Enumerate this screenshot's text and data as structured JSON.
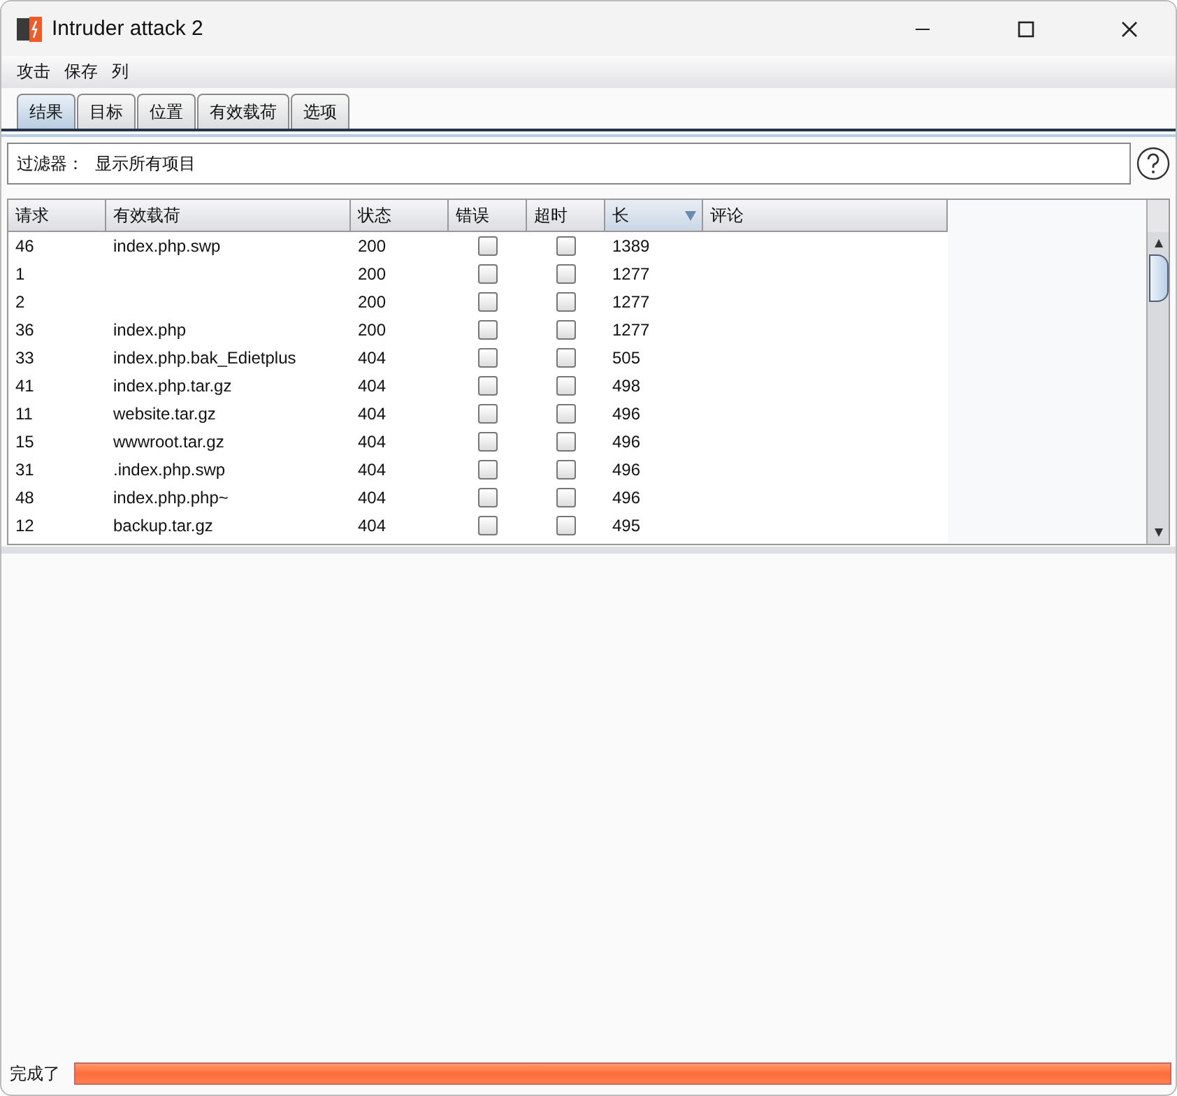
{
  "window": {
    "title": "Intruder attack 2"
  },
  "menu": [
    "攻击",
    "保存",
    "列"
  ],
  "tabs": [
    {
      "label": "结果",
      "selected": true
    },
    {
      "label": "目标",
      "selected": false
    },
    {
      "label": "位置",
      "selected": false
    },
    {
      "label": "有效载荷",
      "selected": false
    },
    {
      "label": "选项",
      "selected": false
    }
  ],
  "filter": {
    "label": "过滤器：",
    "value": "显示所有项目"
  },
  "table": {
    "columns": [
      {
        "label": "请求",
        "sorted": false
      },
      {
        "label": "有效载荷",
        "sorted": false
      },
      {
        "label": "状态",
        "sorted": false
      },
      {
        "label": "错误",
        "sorted": false
      },
      {
        "label": "超时",
        "sorted": false
      },
      {
        "label": "长",
        "sorted": true
      },
      {
        "label": "评论",
        "sorted": false
      }
    ],
    "rows": [
      {
        "request": "46",
        "payload": "index.php.swp",
        "status": "200",
        "error": false,
        "timeout": false,
        "length": "1389"
      },
      {
        "request": "1",
        "payload": "",
        "status": "200",
        "error": false,
        "timeout": false,
        "length": "1277"
      },
      {
        "request": "2",
        "payload": "",
        "status": "200",
        "error": false,
        "timeout": false,
        "length": "1277"
      },
      {
        "request": "36",
        "payload": "index.php",
        "status": "200",
        "error": false,
        "timeout": false,
        "length": "1277"
      },
      {
        "request": "33",
        "payload": "index.php.bak_Edietplus",
        "status": "404",
        "error": false,
        "timeout": false,
        "length": "505"
      },
      {
        "request": "41",
        "payload": "index.php.tar.gz",
        "status": "404",
        "error": false,
        "timeout": false,
        "length": "498"
      },
      {
        "request": "11",
        "payload": "website.tar.gz",
        "status": "404",
        "error": false,
        "timeout": false,
        "length": "496"
      },
      {
        "request": "15",
        "payload": "wwwroot.tar.gz",
        "status": "404",
        "error": false,
        "timeout": false,
        "length": "496"
      },
      {
        "request": "31",
        "payload": ".index.php.swp",
        "status": "404",
        "error": false,
        "timeout": false,
        "length": "496"
      },
      {
        "request": "48",
        "payload": "index.php.php~",
        "status": "404",
        "error": false,
        "timeout": false,
        "length": "496"
      },
      {
        "request": "12",
        "payload": "backup.tar.gz",
        "status": "404",
        "error": false,
        "timeout": false,
        "length": "495"
      }
    ]
  },
  "status_bar": {
    "text": "完成了",
    "progress": {
      "level": 1
    }
  }
}
